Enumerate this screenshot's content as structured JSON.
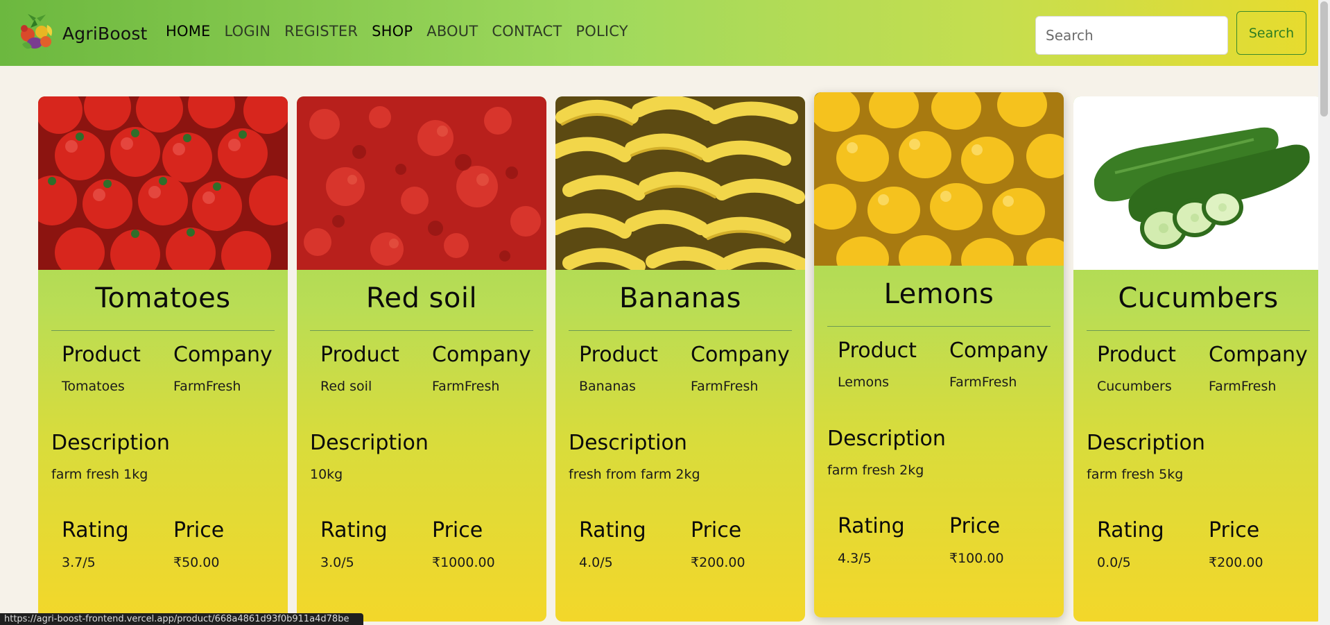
{
  "nav": {
    "brand": "AgriBoost",
    "links": [
      {
        "label": "HOME",
        "active": true
      },
      {
        "label": "LOGIN",
        "active": false
      },
      {
        "label": "REGISTER",
        "active": false
      },
      {
        "label": "SHOP",
        "active": true
      },
      {
        "label": "ABOUT",
        "active": false
      },
      {
        "label": "CONTACT",
        "active": false
      },
      {
        "label": "POLICY",
        "active": false
      }
    ],
    "search_placeholder": "Search",
    "search_button": "Search"
  },
  "labels": {
    "product": "Product",
    "company": "Company",
    "description": "Description",
    "rating": "Rating",
    "price": "Price"
  },
  "products": [
    {
      "title": "Tomatoes",
      "product": "Tomatoes",
      "company": "FarmFresh",
      "description": "farm fresh 1kg",
      "rating": "3.7/5",
      "price": "₹50.00",
      "image": "tomatoes"
    },
    {
      "title": "Red soil",
      "product": "Red soil",
      "company": "FarmFresh",
      "description": "10kg",
      "rating": "3.0/5",
      "price": "₹1000.00",
      "image": "red-soil"
    },
    {
      "title": "Bananas",
      "product": "Bananas",
      "company": "FarmFresh",
      "description": "fresh from farm 2kg",
      "rating": "4.0/5",
      "price": "₹200.00",
      "image": "bananas"
    },
    {
      "title": "Lemons",
      "product": "Lemons",
      "company": "FarmFresh",
      "description": "farm fresh 2kg",
      "rating": "4.3/5",
      "price": "₹100.00",
      "image": "lemons"
    },
    {
      "title": "Cucumbers",
      "product": "Cucumbers",
      "company": "FarmFresh",
      "description": "farm fresh 5kg",
      "rating": "0.0/5",
      "price": "₹200.00",
      "image": "cucumbers"
    }
  ],
  "status_url": "https://agri-boost-frontend.vercel.app/product/668a4861d93f0b911a4d78be",
  "colors": {
    "nav_start": "#6cb83f",
    "nav_end": "#e9db2c",
    "card_top": "#94d653",
    "card_bottom": "#f3d72a",
    "page_bg": "#f6f2e9",
    "search_button_accent": "#2e7d22"
  }
}
